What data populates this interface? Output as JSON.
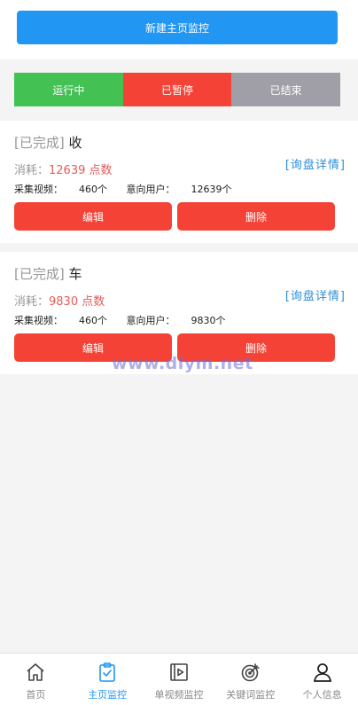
{
  "top": {
    "new_button_label": "新建主页监控"
  },
  "status_tabs": [
    {
      "label": "运行中",
      "color": "#43c153"
    },
    {
      "label": "已暂停",
      "color": "#f44336"
    },
    {
      "label": "已结束",
      "color": "#a09ea6"
    }
  ],
  "cards": [
    {
      "status": "[已完成]",
      "name": "收",
      "cost_label": "消耗：",
      "cost_value": "12639 点数",
      "detail_link": "[询盘详情]",
      "videos_label": "采集视频：",
      "videos_value": "460个",
      "users_label": "意向用户：",
      "users_value": "12639个",
      "edit_label": "编辑",
      "delete_label": "删除"
    },
    {
      "status": "[已完成]",
      "name": "车",
      "cost_label": "消耗：",
      "cost_value": "9830 点数",
      "detail_link": "[询盘详情]",
      "videos_label": "采集视频：",
      "videos_value": "460个",
      "users_label": "意向用户：",
      "users_value": "9830个",
      "edit_label": "编辑",
      "delete_label": "删除"
    }
  ],
  "watermark": "www.dlym.net",
  "tabbar": [
    {
      "label": "首页",
      "icon": "home-icon",
      "active": false
    },
    {
      "label": "主页监控",
      "icon": "clipboard-check-icon",
      "active": true
    },
    {
      "label": "单视频监控",
      "icon": "video-play-icon",
      "active": false
    },
    {
      "label": "关键词监控",
      "icon": "target-icon",
      "active": false
    },
    {
      "label": "个人信息",
      "icon": "user-icon",
      "active": false
    }
  ],
  "colors": {
    "primary": "#2196f3",
    "danger": "#f44336",
    "success": "#43c153",
    "muted": "#a09ea6"
  }
}
